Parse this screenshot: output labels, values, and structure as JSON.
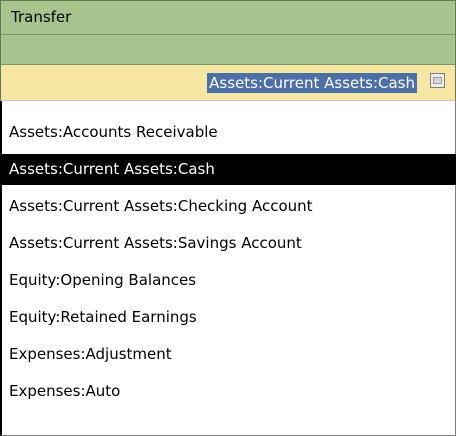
{
  "header": {
    "column_title": "Transfer"
  },
  "transfer_cell": {
    "current_value": "Assets:Current Assets:Cash",
    "combo_icon": "combo-dropdown-icon"
  },
  "dropdown": {
    "selected": "Assets:Current Assets:Cash",
    "items": [
      {
        "label": "Assets:Accounts Receivable"
      },
      {
        "label": "Assets:Current Assets:Cash"
      },
      {
        "label": "Assets:Current Assets:Checking Account"
      },
      {
        "label": "Assets:Current Assets:Savings Account"
      },
      {
        "label": "Equity:Opening Balances"
      },
      {
        "label": "Equity:Retained Earnings"
      },
      {
        "label": "Expenses:Adjustment"
      },
      {
        "label": "Expenses:Auto"
      }
    ]
  },
  "colors": {
    "header_green": "#a7c48f",
    "editing_cell_yellow": "#f7e7a4",
    "selected_text_background": "#4c6fa8",
    "selected_item_background": "#000000"
  }
}
